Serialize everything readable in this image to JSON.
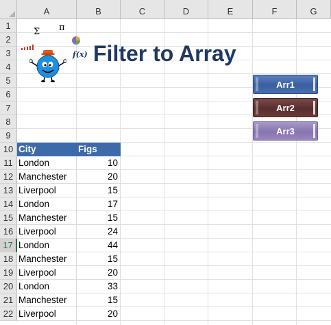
{
  "columns": [
    "A",
    "B",
    "C",
    "D",
    "E",
    "F",
    "G"
  ],
  "rows": [
    "1",
    "2",
    "3",
    "4",
    "5",
    "6",
    "7",
    "8",
    "9",
    "10",
    "11",
    "12",
    "13",
    "14",
    "15",
    "16",
    "17",
    "18",
    "19",
    "20",
    "21",
    "22"
  ],
  "title": "Filter to Array",
  "icons": {
    "sigma": "Σ",
    "pi": "π",
    "fx": "f(x)",
    "figure": "mr-man-icon",
    "pie": "pie-icon",
    "bars": "bars-icon"
  },
  "buttons": [
    {
      "label": "Arr1",
      "color": "#3a5fa0"
    },
    {
      "label": "Arr2",
      "color": "#5a2e2e"
    },
    {
      "label": "Arr3",
      "color": "#8775b0"
    }
  ],
  "table": {
    "headers": [
      "City",
      "Figs"
    ],
    "header_color": "#3d6aa8",
    "data": [
      [
        "London",
        "10"
      ],
      [
        "Manchester",
        "20"
      ],
      [
        "Liverpool",
        "15"
      ],
      [
        "London",
        "17"
      ],
      [
        "Manchester",
        "15"
      ],
      [
        "Liverpool",
        "24"
      ],
      [
        "London",
        "44"
      ],
      [
        "Manchester",
        "15"
      ],
      [
        "Liverpool",
        "20"
      ],
      [
        "London",
        "33"
      ],
      [
        "Manchester",
        "15"
      ],
      [
        "Liverpool",
        "20"
      ]
    ]
  },
  "selected_row": "17"
}
